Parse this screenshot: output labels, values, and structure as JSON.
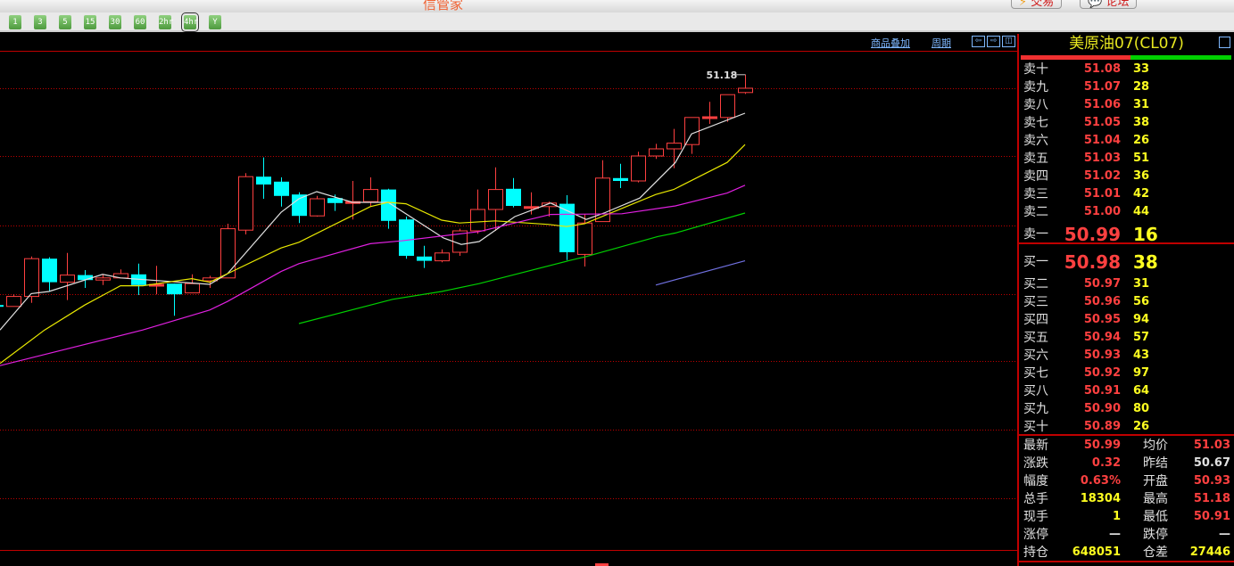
{
  "app": {
    "title": "信管家",
    "trade_label": "交易",
    "forum_label": "论坛"
  },
  "periods": [
    {
      "label": "1"
    },
    {
      "label": "3"
    },
    {
      "label": "5"
    },
    {
      "label": "15"
    },
    {
      "label": "30"
    },
    {
      "label": "60"
    },
    {
      "label": "2hr"
    },
    {
      "label": "4hr",
      "selected": true
    },
    {
      "label": "Y"
    }
  ],
  "chartbar": {
    "overlay_label": "商品叠加",
    "period_label": "周期",
    "left_label": "⇦",
    "right_label": "⇨",
    "layout_label": "◫"
  },
  "colors": {
    "up": "#ff4040",
    "down": "#00ffff",
    "ma5": "#e0e0e0",
    "ma10": "#e8e800",
    "ma20": "#e020e0",
    "ma40": "#00d000",
    "ma60": "#7070e0",
    "grid": "#c00000"
  },
  "chart_data": {
    "type": "candlestick",
    "high_label": "51.18",
    "period": "4hr",
    "candles": [
      [
        -1,
        47.95,
        47.93,
        47.97,
        47.91
      ],
      [
        0,
        47.93,
        48.07,
        48.1,
        47.93
      ],
      [
        1,
        48.07,
        48.6,
        48.63,
        47.98
      ],
      [
        2,
        48.6,
        48.27,
        48.62,
        48.15
      ],
      [
        3,
        48.27,
        48.37,
        48.68,
        48.02
      ],
      [
        4,
        48.37,
        48.3,
        48.44,
        48.19
      ],
      [
        5,
        48.3,
        48.33,
        48.38,
        48.23
      ],
      [
        6,
        48.33,
        48.39,
        48.45,
        48.33
      ],
      [
        7,
        48.38,
        48.23,
        48.53,
        48.09
      ],
      [
        8,
        48.22,
        48.24,
        48.5,
        48.1
      ],
      [
        9,
        48.25,
        48.1,
        48.25,
        47.8
      ],
      [
        10,
        48.12,
        48.25,
        48.38,
        48.12
      ],
      [
        11,
        48.29,
        48.33,
        48.36,
        48.19
      ],
      [
        12,
        48.33,
        49.02,
        49.09,
        48.33
      ],
      [
        13,
        49.0,
        49.75,
        49.8,
        48.94
      ],
      [
        14,
        49.75,
        49.64,
        50.02,
        49.44
      ],
      [
        15,
        49.68,
        49.48,
        49.74,
        49.33
      ],
      [
        16,
        49.5,
        49.2,
        49.53,
        49.1
      ],
      [
        17,
        49.2,
        49.44,
        49.48,
        49.19
      ],
      [
        18,
        49.45,
        49.38,
        49.5,
        49.27
      ],
      [
        19,
        49.38,
        49.4,
        49.69,
        49.15
      ],
      [
        20,
        49.4,
        49.57,
        49.74,
        49.33
      ],
      [
        21,
        49.57,
        49.13,
        49.58,
        49.02
      ],
      [
        22,
        49.15,
        48.64,
        49.19,
        48.6
      ],
      [
        23,
        48.63,
        48.57,
        48.78,
        48.47
      ],
      [
        24,
        48.57,
        48.68,
        48.73,
        48.55
      ],
      [
        25,
        48.69,
        48.99,
        49.02,
        48.64
      ],
      [
        26,
        48.99,
        49.29,
        49.57,
        48.95
      ],
      [
        27,
        49.29,
        49.57,
        49.88,
        48.99
      ],
      [
        28,
        49.58,
        49.34,
        49.73,
        49.32
      ],
      [
        29,
        49.32,
        49.33,
        49.53,
        49.22
      ],
      [
        30,
        49.33,
        49.38,
        49.4,
        49.19
      ],
      [
        31,
        49.37,
        48.69,
        49.49,
        48.58
      ],
      [
        32,
        48.66,
        49.1,
        49.22,
        48.49
      ],
      [
        33,
        49.12,
        49.73,
        49.98,
        49.12
      ],
      [
        34,
        49.73,
        49.69,
        49.93,
        49.59
      ],
      [
        35,
        49.69,
        50.04,
        50.1,
        49.67
      ],
      [
        36,
        50.04,
        50.14,
        50.21,
        50.0
      ],
      [
        37,
        50.14,
        50.22,
        50.42,
        49.87
      ],
      [
        38,
        50.2,
        50.58,
        50.58,
        50.07
      ],
      [
        39,
        50.57,
        50.59,
        50.8,
        50.49
      ],
      [
        40,
        50.58,
        50.9,
        50.9,
        50.52
      ],
      [
        41,
        50.93,
        50.99,
        51.18,
        50.91
      ]
    ],
    "series": [
      {
        "name": "MA5",
        "color": "#e0e0e0",
        "points": [
          [
            -0.75,
            47.6
          ],
          [
            1,
            48.11
          ],
          [
            2,
            48.14
          ],
          [
            5,
            48.38
          ],
          [
            6,
            48.33
          ],
          [
            11,
            48.24
          ],
          [
            12,
            48.39
          ],
          [
            15,
            49.25
          ],
          [
            16,
            49.44
          ],
          [
            17,
            49.54
          ],
          [
            19,
            49.39
          ],
          [
            21,
            49.39
          ],
          [
            24.1,
            48.89
          ],
          [
            25.1,
            48.8
          ],
          [
            26.1,
            48.84
          ],
          [
            28.1,
            49.19
          ],
          [
            30.1,
            49.38
          ],
          [
            32.1,
            49.15
          ],
          [
            33.1,
            49.24
          ],
          [
            35.1,
            49.45
          ],
          [
            37.1,
            49.95
          ],
          [
            38,
            50.35
          ],
          [
            41,
            50.64
          ]
        ]
      },
      {
        "name": "MA10",
        "color": "#e8e800",
        "points": [
          [
            -0.75,
            47.13
          ],
          [
            1.75,
            47.6
          ],
          [
            4,
            47.95
          ],
          [
            6,
            48.22
          ],
          [
            7.25,
            48.22
          ],
          [
            10,
            48.32
          ],
          [
            11,
            48.27
          ],
          [
            12,
            48.39
          ],
          [
            15,
            48.75
          ],
          [
            16,
            48.83
          ],
          [
            20,
            49.33
          ],
          [
            21,
            49.39
          ],
          [
            22,
            49.37
          ],
          [
            24,
            49.14
          ],
          [
            25,
            49.1
          ],
          [
            27,
            49.13
          ],
          [
            30,
            49.08
          ],
          [
            31,
            49.05
          ],
          [
            32,
            49.09
          ],
          [
            36,
            49.5
          ],
          [
            37,
            49.57
          ],
          [
            40,
            49.95
          ],
          [
            41,
            50.2
          ]
        ]
      },
      {
        "name": "MA20",
        "color": "#e020e0",
        "points": [
          [
            -0.75,
            47.1
          ],
          [
            7.25,
            47.6
          ],
          [
            11,
            47.88
          ],
          [
            12,
            48.0
          ],
          [
            15,
            48.42
          ],
          [
            16,
            48.53
          ],
          [
            20,
            48.81
          ],
          [
            21.75,
            48.85
          ],
          [
            26.1,
            48.98
          ],
          [
            30.1,
            49.22
          ],
          [
            34.1,
            49.23
          ],
          [
            37.1,
            49.34
          ],
          [
            40,
            49.52
          ],
          [
            41,
            49.63
          ]
        ]
      },
      {
        "name": "MA40",
        "color": "#00d000",
        "points": [
          [
            16,
            47.69
          ],
          [
            21.25,
            48.03
          ],
          [
            24,
            48.14
          ],
          [
            26.1,
            48.25
          ],
          [
            31.1,
            48.57
          ],
          [
            32.1,
            48.63
          ],
          [
            36.1,
            48.91
          ],
          [
            37.1,
            48.96
          ],
          [
            41,
            49.24
          ]
        ]
      },
      {
        "name": "MA60",
        "color": "#7070e0",
        "points": [
          [
            36,
            48.23
          ],
          [
            41,
            48.57
          ]
        ]
      }
    ]
  },
  "panel": {
    "title": "美原油07(CL07)",
    "asks": [
      {
        "label": "卖十",
        "price": "51.08",
        "vol": "33"
      },
      {
        "label": "卖九",
        "price": "51.07",
        "vol": "28"
      },
      {
        "label": "卖八",
        "price": "51.06",
        "vol": "31"
      },
      {
        "label": "卖七",
        "price": "51.05",
        "vol": "38"
      },
      {
        "label": "卖六",
        "price": "51.04",
        "vol": "26"
      },
      {
        "label": "卖五",
        "price": "51.03",
        "vol": "51"
      },
      {
        "label": "卖四",
        "price": "51.02",
        "vol": "36"
      },
      {
        "label": "卖三",
        "price": "51.01",
        "vol": "42"
      },
      {
        "label": "卖二",
        "price": "51.00",
        "vol": "44"
      },
      {
        "label": "卖一",
        "price": "50.99",
        "vol": "16"
      }
    ],
    "bids": [
      {
        "label": "买一",
        "price": "50.98",
        "vol": "38"
      },
      {
        "label": "买二",
        "price": "50.97",
        "vol": "31"
      },
      {
        "label": "买三",
        "price": "50.96",
        "vol": "56"
      },
      {
        "label": "买四",
        "price": "50.95",
        "vol": "94"
      },
      {
        "label": "买五",
        "price": "50.94",
        "vol": "57"
      },
      {
        "label": "买六",
        "price": "50.93",
        "vol": "43"
      },
      {
        "label": "买七",
        "price": "50.92",
        "vol": "97"
      },
      {
        "label": "买八",
        "price": "50.91",
        "vol": "64"
      },
      {
        "label": "买九",
        "price": "50.90",
        "vol": "80"
      },
      {
        "label": "买十",
        "price": "50.89",
        "vol": "26"
      }
    ],
    "stats": [
      {
        "l1": "最新",
        "v1": "50.99",
        "c1": "#ff4040",
        "l2": "均价",
        "v2": "51.03",
        "c2": "#ff4040"
      },
      {
        "l1": "涨跌",
        "v1": "0.32",
        "c1": "#ff4040",
        "l2": "昨结",
        "v2": "50.67",
        "c2": "#e0e0e0"
      },
      {
        "l1": "幅度",
        "v1": "0.63%",
        "c1": "#ff4040",
        "l2": "开盘",
        "v2": "50.93",
        "c2": "#ff4040"
      },
      {
        "l1": "总手",
        "v1": "18304",
        "c1": "#ffff20",
        "l2": "最高",
        "v2": "51.18",
        "c2": "#ff4040"
      },
      {
        "l1": "现手",
        "v1": "1",
        "c1": "#ffff20",
        "l2": "最低",
        "v2": "50.91",
        "c2": "#ff4040"
      },
      {
        "l1": "涨停",
        "v1": "—",
        "c1": "#e0e0e0",
        "l2": "跌停",
        "v2": "—",
        "c2": "#e0e0e0"
      },
      {
        "l1": "持仓",
        "v1": "648051",
        "c1": "#ffff20",
        "l2": "仓差",
        "v2": "27446",
        "c2": "#ffff20"
      }
    ]
  }
}
